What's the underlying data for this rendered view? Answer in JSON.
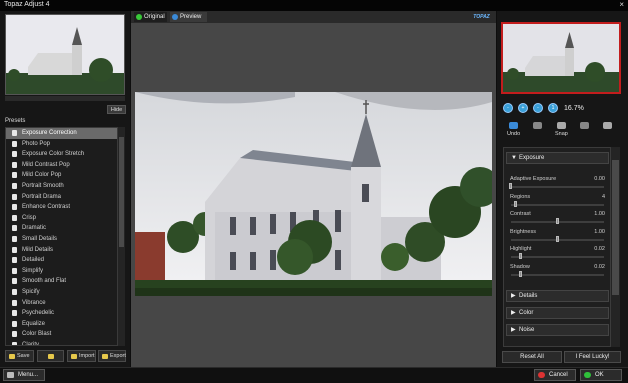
{
  "window": {
    "title": "Topaz Adjust 4",
    "close_glyph": "×"
  },
  "left": {
    "hide_label": "Hide",
    "presets_label": "Presets",
    "presets": [
      "Exposure Correction",
      "Photo Pop",
      "Exposure Color Stretch",
      "Mild Contrast Pop",
      "Mild Color Pop",
      "Portrait Smooth",
      "Portrait Drama",
      "Enhance Contrast",
      "Crisp",
      "Dramatic",
      "Small Details",
      "Mild Details",
      "Detailed",
      "Simplify",
      "Smooth and Flat",
      "Spicify",
      "Vibrance",
      "Psychedelic",
      "Equalize",
      "Color Blast",
      "Clarity"
    ],
    "selected_preset": "Exposure Correction",
    "buttons": {
      "save": "Save",
      "import": "Import",
      "export": "Export"
    }
  },
  "center": {
    "tabs": {
      "original": "Original",
      "preview": "Preview"
    },
    "active_tab": "Preview",
    "logo_text": "TOPAZ"
  },
  "right": {
    "zoom_percent": "16.7%",
    "toolbar": {
      "undo": "Undo",
      "snap": "Snap"
    },
    "sections": {
      "exposure": "Exposure",
      "details": "Details",
      "color": "Color",
      "noise": "Noise"
    },
    "sliders": [
      {
        "label": "Adaptive Exposure",
        "value": "0.00",
        "level": 0.0
      },
      {
        "label": "Regions",
        "value": "4",
        "level": 0.05
      },
      {
        "label": "Contrast",
        "value": "1.00",
        "level": 0.5
      },
      {
        "label": "Brightness",
        "value": "1.00",
        "level": 0.5
      },
      {
        "label": "Highlight",
        "value": "0.02",
        "level": 0.11
      },
      {
        "label": "Shadow",
        "value": "0.02",
        "level": 0.11
      }
    ],
    "buttons": {
      "reset": "Reset All",
      "lucky": "I Feel Lucky!"
    }
  },
  "bottom": {
    "menu": "Menu...",
    "cancel": "Cancel",
    "ok": "OK"
  },
  "colors": {
    "accent_red": "#c21d1d",
    "zoom_blue": "#3aa0d8",
    "folder_yellow": "#e6c84b",
    "ok_green": "#2fbf3a",
    "cancel_red": "#d33"
  },
  "icons": [
    "close-icon",
    "document-icon",
    "save-icon",
    "folder-icon",
    "import-icon",
    "export-icon",
    "zoom-fit-icon",
    "zoom-in-icon",
    "zoom-out-icon",
    "zoom-actual-icon",
    "undo-icon",
    "redo-icon",
    "snap-icon",
    "compare-icon",
    "message-icon",
    "menu-icon",
    "cancel-icon",
    "ok-icon"
  ]
}
